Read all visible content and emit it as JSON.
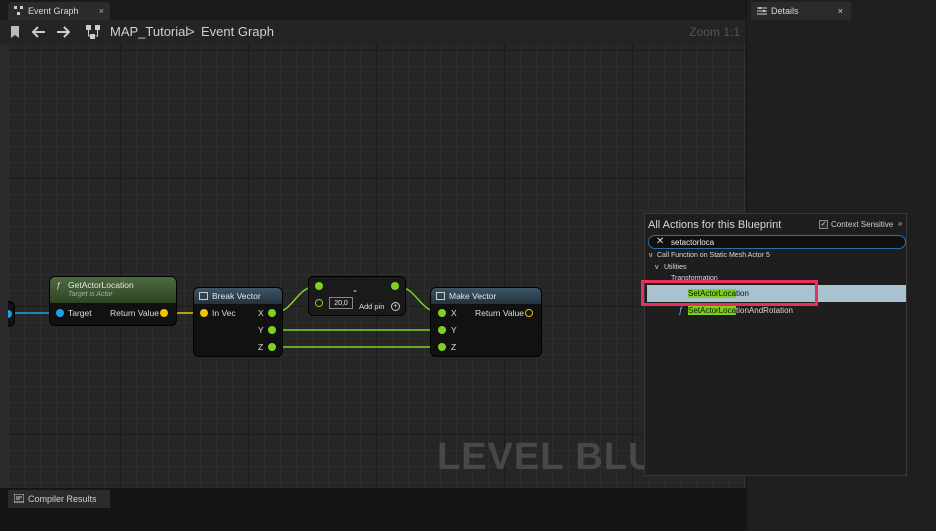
{
  "tabs": {
    "event_graph": "Event Graph",
    "close": "×"
  },
  "toolbar": {
    "path_root": "MAP_Tutorial",
    "separator": ">",
    "path_leaf": "Event Graph",
    "zoom": "Zoom 1:1"
  },
  "graph": {
    "watermark": "LEVEL BLUEI",
    "node_get_actor_location": {
      "title": "GetActorLocation",
      "subtitle": "Target is Actor",
      "pin_in": "Target",
      "pin_out": "Return Value"
    },
    "node_break_vector": {
      "title": "Break Vector",
      "pin_in": "In Vec",
      "pins_out": [
        "X",
        "Y",
        "Z"
      ]
    },
    "node_subtract": {
      "symbol": "-",
      "value": "20,0",
      "add_pin": "Add pin"
    },
    "node_make_vector": {
      "title": "Make Vector",
      "pins_in": [
        "X",
        "Y",
        "Z"
      ],
      "pin_out": "Return Value"
    }
  },
  "compiler": {
    "tab_label": "Compiler Results"
  },
  "details": {
    "tab_label": "Details",
    "close": "×"
  },
  "popup": {
    "title": "All Actions for this Blueprint",
    "context_label": "Context Sensitive",
    "context_checked": true,
    "search_value": "setactorloca",
    "category": "Call Function on Static Mesh Actor 5",
    "subcategory": "Utilities",
    "sub2": "Transformation",
    "results": [
      {
        "match": "SetActorLoca",
        "rest": "tion",
        "selected": true
      },
      {
        "match": "SetActorLoca",
        "rest": "tionAndRotation",
        "selected": false
      }
    ]
  },
  "colors": {
    "accent_highlight": "#e8305a",
    "match_green": "#7bcf1d",
    "vector_pin": "#f0c200",
    "float_pin": "#7fd320",
    "object_pin": "#1ea0e8"
  }
}
